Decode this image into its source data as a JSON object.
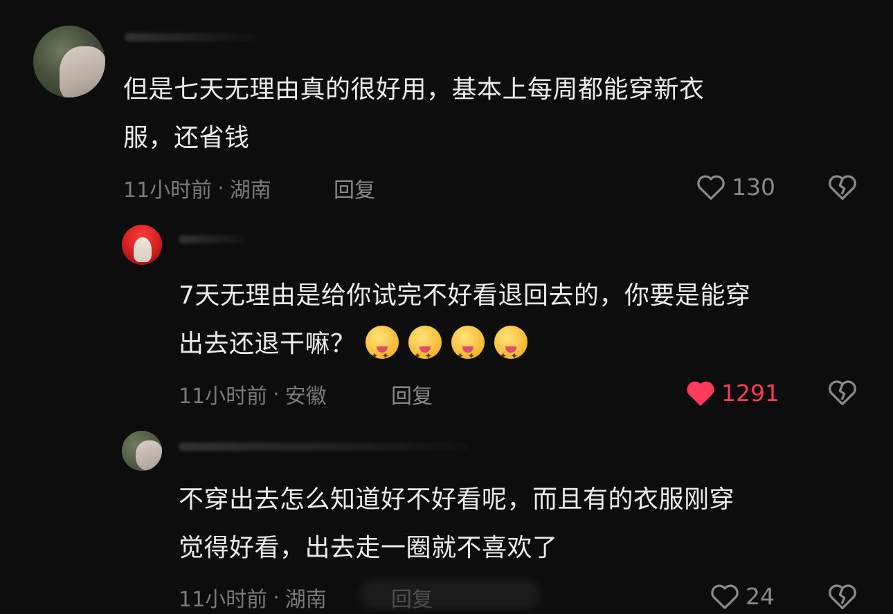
{
  "comments": [
    {
      "text": "但是七天无理由真的很好用，基本上每周都能穿新衣服，还省钱",
      "line1": "但是七天无理由真的很好用，基本上每周都能穿新衣",
      "line2": "服，还省钱",
      "time": "11小时前",
      "location": "湖南",
      "reply_label": "回复",
      "likes": "130",
      "liked": false
    },
    {
      "line1": "7天无理由是给你试完不好看退回去的，你要是能穿",
      "line2": "出去还退干嘛？",
      "emojis": [
        "drooling-face-emoji",
        "drooling-face-emoji",
        "drooling-face-emoji",
        "drooling-face-emoji"
      ],
      "time": "11小时前",
      "location": "安徽",
      "reply_label": "回复",
      "likes": "1291",
      "liked": true
    },
    {
      "line1": "不穿出去怎么知道好不好看呢，而且有的衣服刚穿",
      "line2": "觉得好看，出去走一圈就不喜欢了",
      "time": "11小时前",
      "location": "湖南",
      "reply_label": "回复",
      "likes": "24",
      "liked": false
    }
  ],
  "separator": "·",
  "colors": {
    "liked": "#ff3b5c",
    "muted": "#8a8a8a",
    "background": "#0d0d0d"
  },
  "icons": [
    "heart-outline-icon",
    "heart-filled-icon",
    "broken-heart-icon"
  ]
}
